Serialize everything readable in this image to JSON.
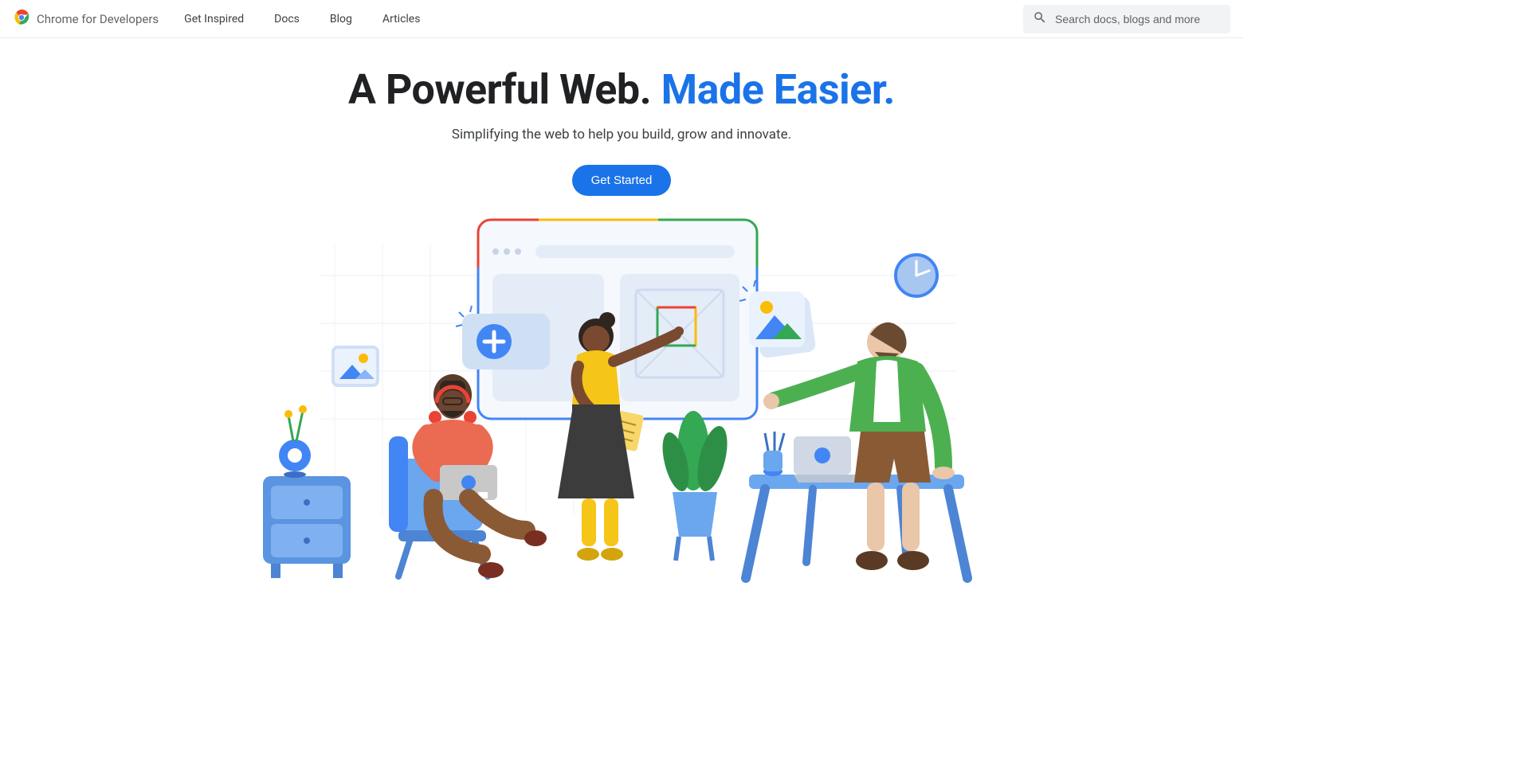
{
  "header": {
    "brand": "Chrome for Developers",
    "nav": [
      "Get Inspired",
      "Docs",
      "Blog",
      "Articles"
    ],
    "search_placeholder": "Search docs, blogs and more"
  },
  "hero": {
    "headline_part1": "A Powerful Web. ",
    "headline_part2": "Made Easier.",
    "subtitle": "Simplifying the web to help you build, grow and innovate.",
    "cta_label": "Get Started"
  }
}
